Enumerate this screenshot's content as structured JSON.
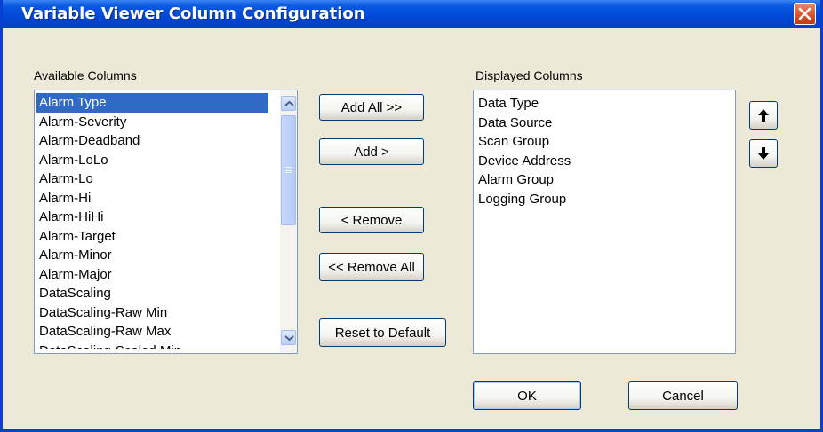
{
  "window": {
    "title": "Variable Viewer Column Configuration"
  },
  "available": {
    "label": "Available Columns",
    "items": [
      "Alarm Type",
      "Alarm-Severity",
      "Alarm-Deadband",
      "Alarm-LoLo",
      "Alarm-Lo",
      "Alarm-Hi",
      "Alarm-HiHi",
      "Alarm-Target",
      "Alarm-Minor",
      "Alarm-Major",
      "DataScaling",
      "DataScaling-Raw Min",
      "DataScaling-Raw Max",
      "DataScaling-Scaled Min"
    ],
    "selected": "Alarm Type"
  },
  "displayed": {
    "label": "Displayed Columns",
    "items": [
      "Data Type",
      "Data Source",
      "Scan Group",
      "Device Address",
      "Alarm Group",
      "Logging Group"
    ]
  },
  "buttons": {
    "add_all": "Add All >>",
    "add": "Add >",
    "remove": "< Remove",
    "remove_all": "<< Remove All",
    "reset": "Reset to Default",
    "ok": "OK",
    "cancel": "Cancel"
  },
  "icons": {
    "close": "close-icon",
    "move_up": "arrow-up-icon",
    "move_down": "arrow-down-icon",
    "scroll_up": "chevron-up-icon",
    "scroll_down": "chevron-down-icon"
  }
}
